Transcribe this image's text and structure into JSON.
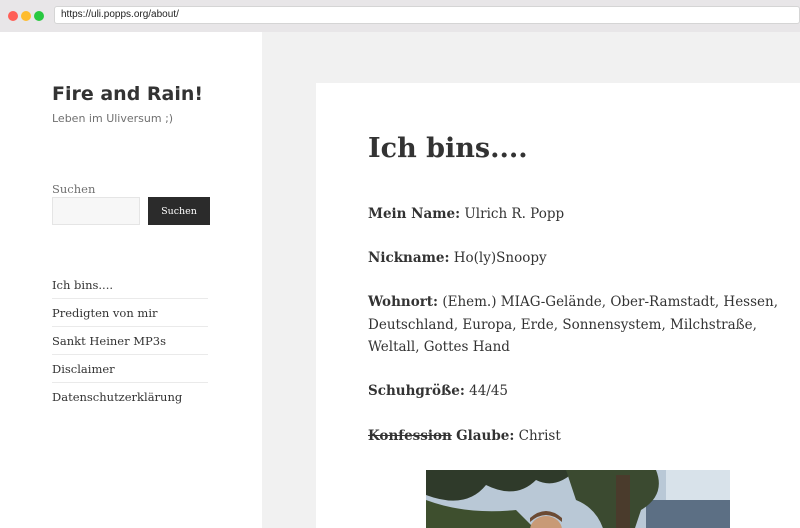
{
  "browser": {
    "url": "https://uli.popps.org/about/"
  },
  "sidebar": {
    "site_title": "Fire and Rain!",
    "site_description": "Leben im Uliversum ;)",
    "search": {
      "label": "Suchen",
      "placeholder": "",
      "value": "",
      "button_label": "Suchen"
    },
    "nav_items": [
      {
        "label": "Ich bins...."
      },
      {
        "label": "Predigten von mir"
      },
      {
        "label": "Sankt Heiner MP3s"
      },
      {
        "label": "Disclaimer"
      },
      {
        "label": "Datenschutzerklärung"
      }
    ]
  },
  "article": {
    "title": "Ich bins....",
    "fields": [
      {
        "label": "Mein Name:",
        "value": "Ulrich R. Popp"
      },
      {
        "label": "Nickname:",
        "value": "Ho(ly)Snoopy"
      },
      {
        "label": "Wohnort:",
        "value": "(Ehem.) MIAG-Gelände, Ober-Ramstadt, Hessen, Deutschland, Europa, Erde, Sonnensystem, Milchstraße, Weltall, Gottes Hand"
      },
      {
        "label": "Schuhgröße:",
        "value": "44/45"
      }
    ],
    "religion": {
      "struck_label": "Konfession",
      "label": "Glaube:",
      "value": "Christ"
    }
  },
  "colors": {
    "sidebar_bg": "#ffffff",
    "page_bg": "#f1f1f1",
    "button_bg": "#2b2b2b",
    "text": "#333333",
    "muted_text": "#707070"
  }
}
